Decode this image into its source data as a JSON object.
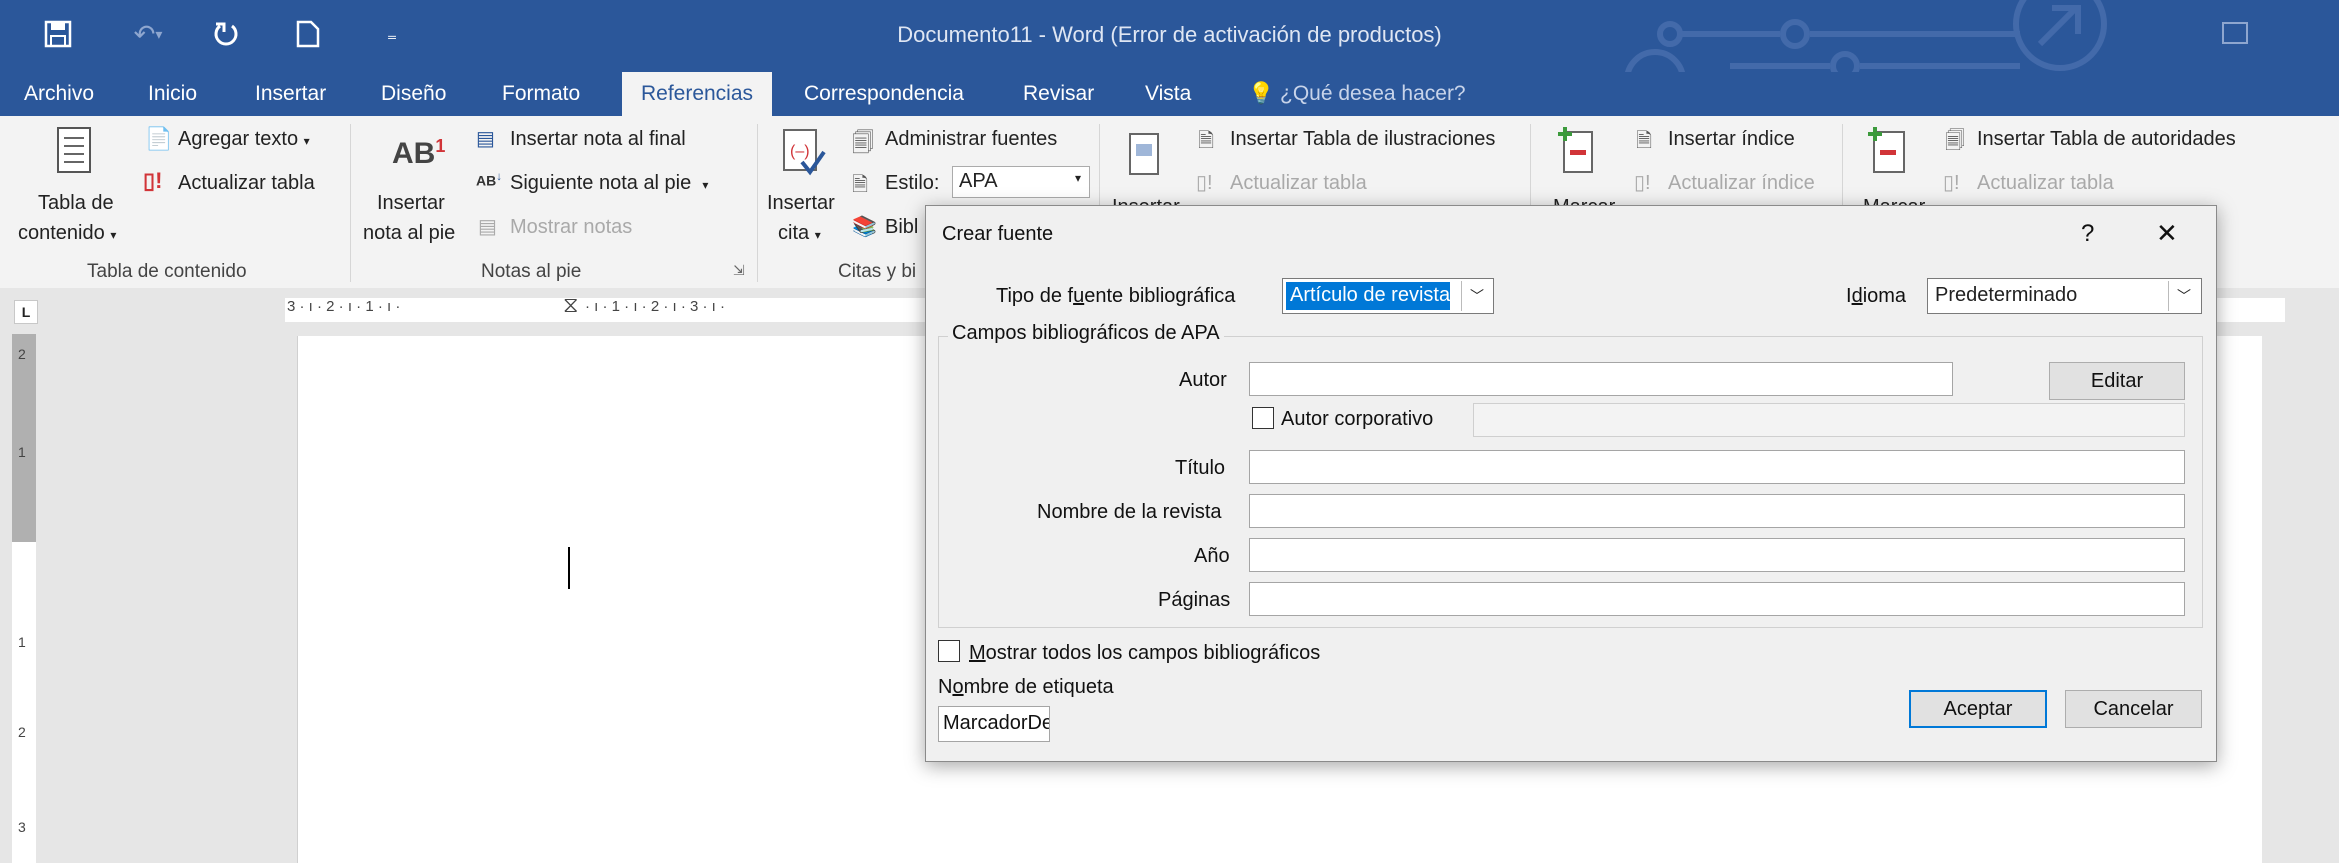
{
  "window": {
    "title": "Documento11 - Word (Error de activación de productos)"
  },
  "quick_access": [
    "save-icon",
    "undo-icon",
    "redo-icon",
    "new-document-icon",
    "customize-qat-icon"
  ],
  "tabs": [
    "Archivo",
    "Inicio",
    "Insertar",
    "Diseño",
    "Formato",
    "Referencias",
    "Correspondencia",
    "Revisar",
    "Vista"
  ],
  "active_tab": "Referencias",
  "tell_me": "¿Qué desea hacer?",
  "ribbon": {
    "toc": {
      "big_button": [
        "Tabla de",
        "contenido"
      ],
      "add_text": "Agregar texto",
      "update_table": "Actualizar tabla",
      "group_label": "Tabla de contenido"
    },
    "footnotes": {
      "icon_text": "AB",
      "icon_sup": "1",
      "big_button": [
        "Insertar",
        "nota al pie"
      ],
      "insert_endnote": "Insertar nota al final",
      "next_footnote": "Siguiente nota al pie",
      "show_notes": "Mostrar notas",
      "group_label": "Notas al pie"
    },
    "citations": {
      "big_button": [
        "Insertar",
        "cita"
      ],
      "manage_sources": "Administrar fuentes",
      "style_label": "Estilo:",
      "style_value": "APA",
      "bibliography": "Bibl",
      "group_label": "Citas y bi"
    },
    "captions": {
      "big_button": "Insertar",
      "insert_table_figures": "Insertar Tabla de ilustraciones",
      "update_table": "Actualizar tabla"
    },
    "index": {
      "big_button": "Marcar",
      "insert_index": "Insertar índice",
      "update_index": "Actualizar índice"
    },
    "authorities": {
      "big_button": "Marcar",
      "insert_table_authorities": "Insertar Tabla de autoridades",
      "update_table": "Actualizar tabla"
    }
  },
  "ruler": {
    "left_marks": "3 · ı · 2 · ı · 1 · ı ·",
    "right_marks": "· ı · 1 · ı · 2 · ı · 3 · ı ·",
    "vertical_marks": [
      "2",
      "1",
      "1",
      "2",
      "3"
    ],
    "tab_selector": "L"
  },
  "dialog": {
    "title": "Crear fuente",
    "help": "?",
    "close": "✕",
    "source_type_label_pre": "Tipo de f",
    "source_type_label_u": "u",
    "source_type_label_post": "ente bibliográfica",
    "source_type_value": "Artículo de revista",
    "language_label_pre": "I",
    "language_label_u": "d",
    "language_label_post": "ioma",
    "language_value": "Predeterminado",
    "fieldset_label": "Campos bibliográficos de APA",
    "author_label": "Autor",
    "edit_button": "Editar",
    "corporate_author_label": "Autor corporativo",
    "title_label": "Título",
    "journal_label": "Nombre de la revista",
    "year_label": "Año",
    "pages_label": "Páginas",
    "show_all_pre": "",
    "show_all_u": "M",
    "show_all_post": "ostrar todos los campos bibliográficos",
    "tag_label_pre": "N",
    "tag_label_u": "o",
    "tag_label_post": "mbre de etiqueta",
    "tag_value": "MarcadorDePosicio",
    "ok_button": "Aceptar",
    "cancel_button": "Cancelar"
  }
}
